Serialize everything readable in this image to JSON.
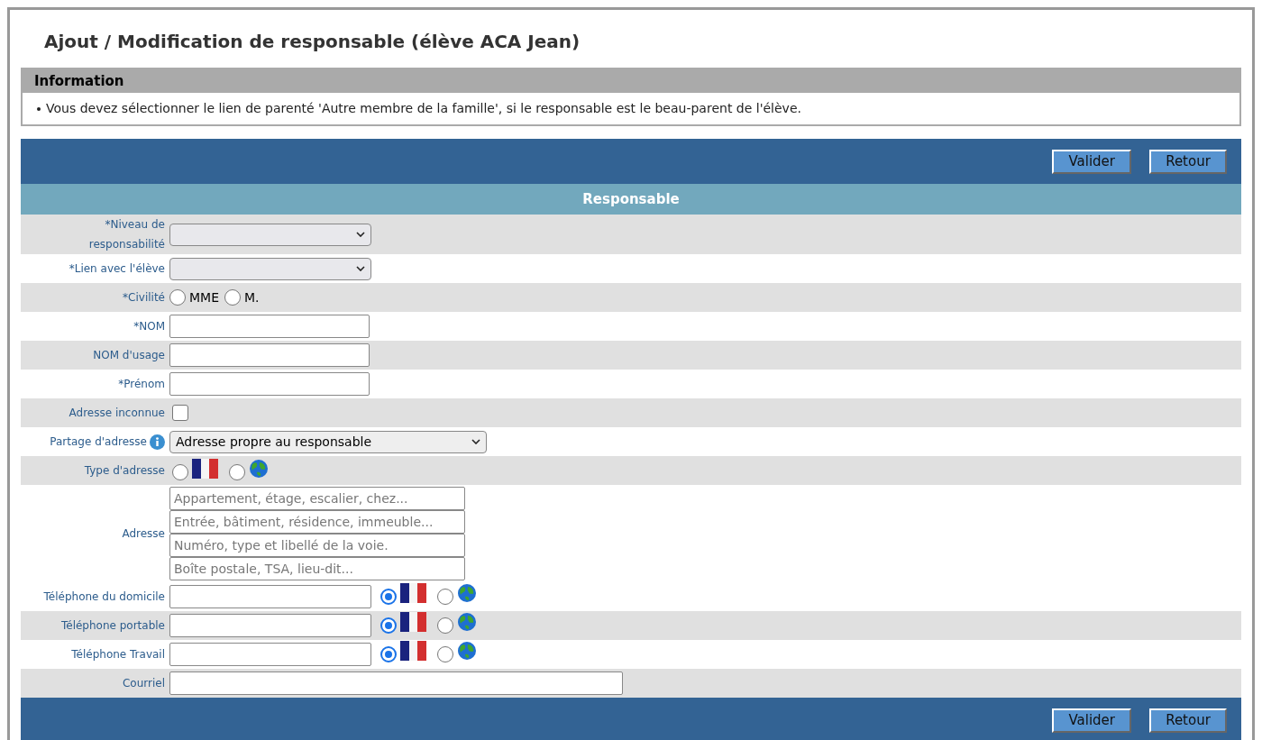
{
  "title": "Ajout / Modification de responsable (élève ACA Jean)",
  "information": {
    "heading": "Information",
    "items": [
      "Vous devez sélectionner le lien de parenté 'Autre membre de la famille', si le responsable est le beau-parent de l'élève."
    ]
  },
  "top_buttons": [
    "Valider",
    "Retour"
  ],
  "section_title": "Responsable",
  "rows": [
    {
      "kind": "select",
      "label": "*Niveau de responsabilité"
    },
    {
      "kind": "select",
      "label": "*Lien avec l'élève"
    },
    {
      "kind": "radios",
      "label": "*Civilité",
      "options": [
        {
          "label": "MME",
          "selected": false
        },
        {
          "label": "M.",
          "selected": false
        }
      ]
    },
    {
      "kind": "text",
      "label": "*NOM"
    },
    {
      "kind": "text",
      "label": "NOM d'usage"
    },
    {
      "kind": "text",
      "label": "*Prénom"
    },
    {
      "kind": "checkbox",
      "label": "Adresse inconnue",
      "checked": false
    },
    {
      "kind": "select",
      "label": "Partage d'adresse",
      "info": true,
      "value": "Adresse propre au responsable"
    },
    {
      "kind": "origin",
      "label": "Type d'adresse",
      "options": [
        {
          "kind": "france",
          "selected": false
        },
        {
          "kind": "world",
          "selected": false
        }
      ]
    },
    {
      "kind": "address",
      "label": "Adresse",
      "placeholders": [
        "Appartement, étage, escalier, chez...",
        "Entrée, bâtiment, résidence, immeuble...",
        "Numéro, type et libellé de la voie.",
        "Boîte postale, TSA, lieu-dit..."
      ]
    },
    {
      "kind": "phone",
      "label": "Téléphone du domicile",
      "options": [
        {
          "kind": "france",
          "selected": true
        },
        {
          "kind": "world",
          "selected": false
        }
      ]
    },
    {
      "kind": "phone",
      "label": "Téléphone portable",
      "options": [
        {
          "kind": "france",
          "selected": true
        },
        {
          "kind": "world",
          "selected": false
        }
      ]
    },
    {
      "kind": "phone",
      "label": "Téléphone Travail",
      "options": [
        {
          "kind": "france",
          "selected": true
        },
        {
          "kind": "world",
          "selected": false
        }
      ]
    },
    {
      "kind": "email",
      "label": "Courriel"
    }
  ],
  "bottom_buttons": [
    "Valider",
    "Retour"
  ]
}
